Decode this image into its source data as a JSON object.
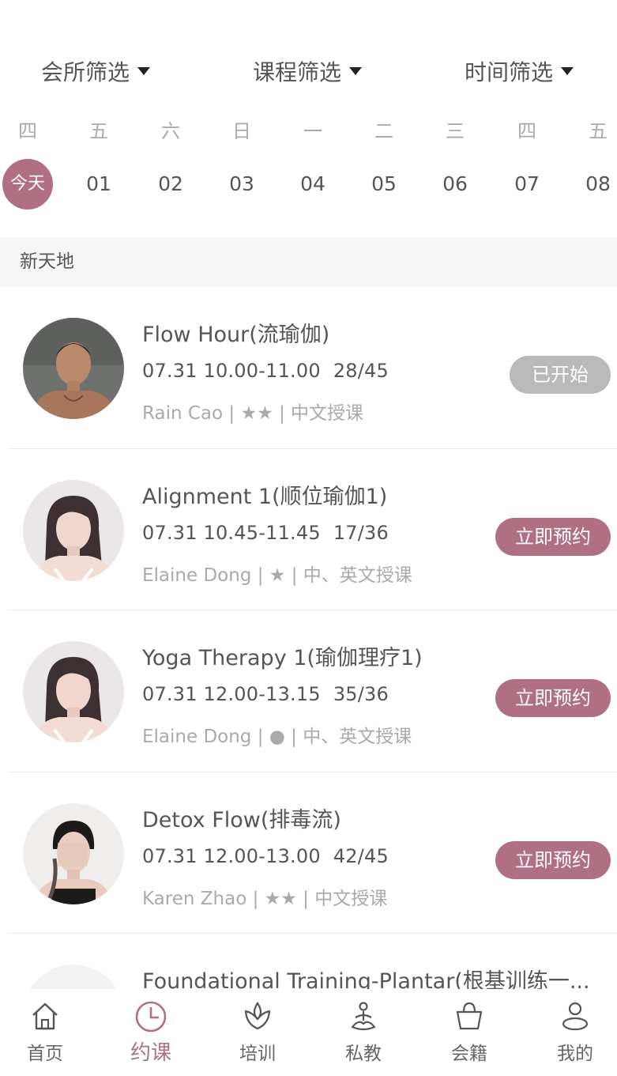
{
  "filters": [
    {
      "label": "会所筛选"
    },
    {
      "label": "课程筛选"
    },
    {
      "label": "时间筛选"
    }
  ],
  "week": {
    "weekdays": [
      "四",
      "五",
      "六",
      "日",
      "一",
      "二",
      "三",
      "四",
      "五"
    ],
    "dates": [
      "今天",
      "01",
      "02",
      "03",
      "04",
      "05",
      "06",
      "07",
      "08"
    ]
  },
  "section": {
    "title": "新天地"
  },
  "classes": [
    {
      "name": "Flow Hour(流瑜伽)",
      "time": "07.31 10.00-11.00",
      "capacity": "28/45",
      "meta": "Rain Cao | ★★ | 中文授课",
      "button": "已开始",
      "status": "started"
    },
    {
      "name": "Alignment 1(顺位瑜伽1)",
      "time": "07.31 10.45-11.45",
      "capacity": "17/36",
      "meta": "Elaine Dong | ★ | 中、英文授课",
      "button": "立即预约",
      "status": "book"
    },
    {
      "name": "Yoga Therapy 1(瑜伽理疗1)",
      "time": "07.31 12.00-13.15",
      "capacity": "35/36",
      "meta": "Elaine Dong | ● | 中、英文授课",
      "button": "立即预约",
      "status": "book"
    },
    {
      "name": "Detox Flow(排毒流)",
      "time": "07.31 12.00-13.00",
      "capacity": "42/45",
      "meta": "Karen Zhao | ★★ | 中文授课",
      "button": "立即预约",
      "status": "book"
    },
    {
      "name": "Foundational Training-Plantar(根基训练一..."
    }
  ],
  "tabs": [
    {
      "label": "首页",
      "icon": "home-icon"
    },
    {
      "label": "约课",
      "icon": "clock-icon",
      "active": true
    },
    {
      "label": "培训",
      "icon": "lotus-icon"
    },
    {
      "label": "私教",
      "icon": "meditation-icon"
    },
    {
      "label": "会籍",
      "icon": "shopping-basket-icon"
    },
    {
      "label": "我的",
      "icon": "person-icon"
    }
  ],
  "colors": {
    "accent": "#b06f83",
    "started": "#b9b9b9",
    "section_bg": "#f6f6f6"
  }
}
